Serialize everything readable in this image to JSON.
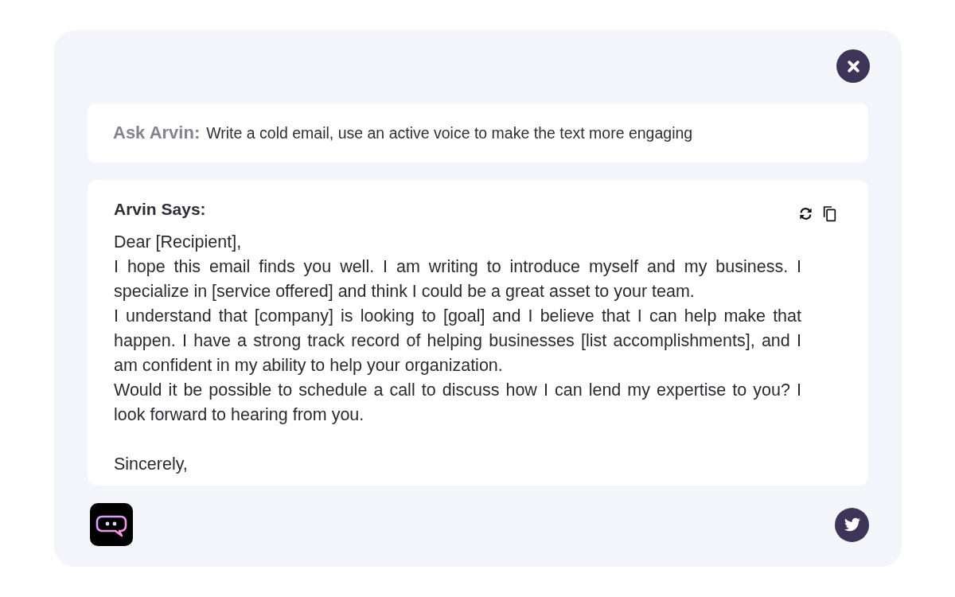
{
  "prompt": {
    "label": "Ask Arvin:",
    "text": "Write a cold email, use an active voice to make the text more engaging"
  },
  "response": {
    "heading": "Arvin Says:",
    "paragraphs": [
      {
        "kind": "greeting",
        "text": "Dear [Recipient],"
      },
      {
        "kind": "body",
        "text": "I hope this email finds you well. I am writing to introduce myself and my business. I specialize in [service offered] and think I could be a great asset to your team."
      },
      {
        "kind": "body",
        "text": "I understand that [company] is looking to [goal] and I believe that I can help make that happen. I have a strong track record of helping businesses [list accomplishments], and I am confident in my ability to help your organization."
      },
      {
        "kind": "body",
        "text": "Would it be possible to schedule a call to discuss how I can lend my expertise to you? I look forward to hearing from you."
      },
      {
        "kind": "closing",
        "text": "Sincerely,"
      }
    ]
  }
}
